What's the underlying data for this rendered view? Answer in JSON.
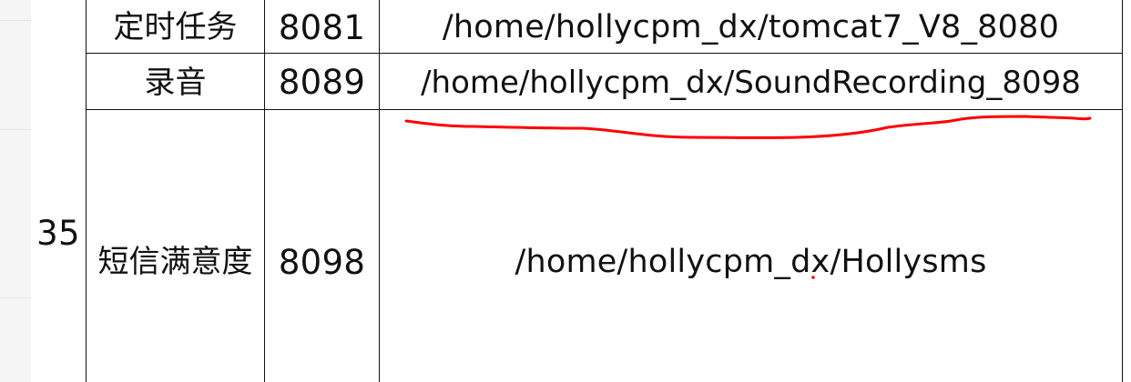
{
  "spreadsheet": {
    "row_number": "35",
    "rows": [
      {
        "name": "定时任务",
        "port": "8081",
        "path": "/home/hollycpm_dx/tomcat7_V8_8080"
      },
      {
        "name": "录音",
        "port": "8089",
        "path": "/home/hollycpm_dx/SoundRecording_8098"
      },
      {
        "name": "短信满意度",
        "port": "8098",
        "path": "/home/hollycpm_dx/Hollysms"
      }
    ]
  },
  "annotation": {
    "color": "#ff0000"
  }
}
